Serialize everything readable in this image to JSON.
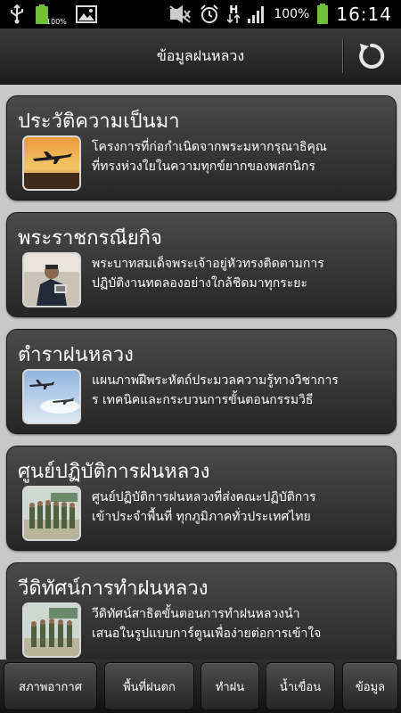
{
  "status_bar": {
    "battery_small_label": "100%",
    "network_type": "H",
    "battery_percent": "100%",
    "time": "16:14"
  },
  "header": {
    "title": "ข้อมูลฝนหลวง",
    "refresh_icon": "refresh-icon"
  },
  "items": [
    {
      "title": "ประวัติความเป็นมา",
      "line1": "โครงการที่ก่อกำเนิดจากพระมหากรุณาธิคุณ",
      "line2": "ที่ทรงห่วงใยในความทุกข์ยากของพสกนิกร",
      "thumb": "airplane-sunset-image"
    },
    {
      "title": "พระราชกรณียกิจ",
      "line1": "พระบาทสมเด็จพระเจ้าอยู่หัวทรงติดตามการ",
      "line2": "ปฏิบัติงานทดลองอย่างใกล้ชิดมาทุกระยะ",
      "thumb": "king-portrait-image"
    },
    {
      "title": "ตำราฝนหลวง",
      "line1": "แผนภาพฝีพระหัตถ์ประมวลความรู้ทางวิชาการ",
      "line2": "ร เทคนิคและกระบวนการขั้นตอนกรรมวิธี",
      "thumb": "airplanes-sky-image"
    },
    {
      "title": "ศูนย์ปฏิบัติการฝนหลวง",
      "line1": "ศูนย์ปฏิบัติการฝนหลวงที่ส่งคณะปฏิบัติการ",
      "line2": "เข้าประจำพื้นที่ ทุกภูมิภาคทั่วประเทศไทย",
      "thumb": "crew-lineup-image"
    },
    {
      "title": "วีดิทัศน์การทำฝนหลวง",
      "line1": "วีดิทัศน์สาธิตขั้นตอนการทำฝนหลวงนำ",
      "line2": "เสนอในรูปแบบการ์ตูนเพื่อง่ายต่อการเข้าใจ",
      "thumb": "crew-video-image"
    }
  ],
  "nav": [
    "สภาพอากาศ",
    "พื้นที่ฝนตก",
    "ทำฝน",
    "น้ำเขื่อน",
    "ข้อมูล"
  ]
}
